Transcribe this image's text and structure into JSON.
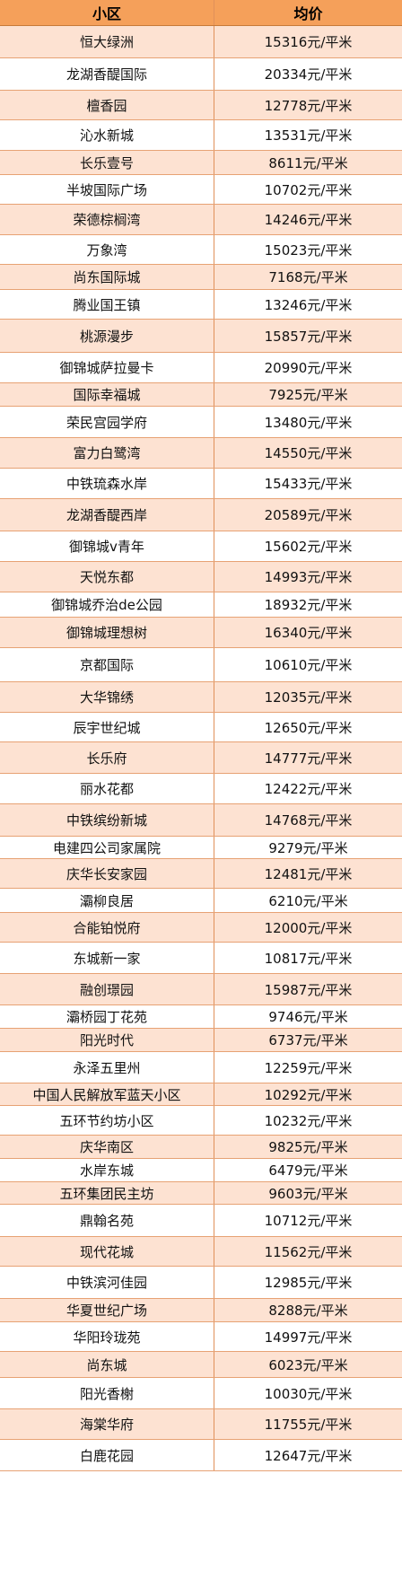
{
  "header": {
    "col1": "小区",
    "col2": "均价"
  },
  "rows": [
    {
      "name": "恒大绿洲",
      "price": "15316元/平米"
    },
    {
      "name": "龙湖香醍国际",
      "price": "20334元/平米"
    },
    {
      "name": "檀香园",
      "price": "12778元/平米"
    },
    {
      "name": "沁水新城",
      "price": "13531元/平米"
    },
    {
      "name": "长乐壹号",
      "price": "8611元/平米"
    },
    {
      "name": "半坡国际广场",
      "price": "10702元/平米"
    },
    {
      "name": "荣德棕榈湾",
      "price": "14246元/平米"
    },
    {
      "name": "万象湾",
      "price": "15023元/平米"
    },
    {
      "name": "尚东国际城",
      "price": "7168元/平米"
    },
    {
      "name": "腾业国王镇",
      "price": "13246元/平米"
    },
    {
      "name": "桃源漫步",
      "price": "15857元/平米"
    },
    {
      "name": "御锦城萨拉曼卡",
      "price": "20990元/平米"
    },
    {
      "name": "国际幸福城",
      "price": "7925元/平米"
    },
    {
      "name": "荣民宫园学府",
      "price": "13480元/平米"
    },
    {
      "name": "富力白鹭湾",
      "price": "14550元/平米"
    },
    {
      "name": "中铁琉森水岸",
      "price": "15433元/平米"
    },
    {
      "name": "龙湖香醍西岸",
      "price": "20589元/平米"
    },
    {
      "name": "御锦城v青年",
      "price": "15602元/平米"
    },
    {
      "name": "天悦东都",
      "price": "14993元/平米"
    },
    {
      "name": "御锦城乔治de公园",
      "price": "18932元/平米"
    },
    {
      "name": "御锦城理想树",
      "price": "16340元/平米"
    },
    {
      "name": "京都国际",
      "price": "10610元/平米"
    },
    {
      "name": "大华锦绣",
      "price": "12035元/平米"
    },
    {
      "name": "辰宇世纪城",
      "price": "12650元/平米"
    },
    {
      "name": "长乐府",
      "price": "14777元/平米"
    },
    {
      "name": "丽水花都",
      "price": "12422元/平米"
    },
    {
      "name": "中铁缤纷新城",
      "price": "14768元/平米"
    },
    {
      "name": "电建四公司家属院",
      "price": "9279元/平米"
    },
    {
      "name": "庆华长安家园",
      "price": "12481元/平米"
    },
    {
      "name": "灞柳良居",
      "price": "6210元/平米"
    },
    {
      "name": "合能铂悦府",
      "price": "12000元/平米"
    },
    {
      "name": "东城新一家",
      "price": "10817元/平米"
    },
    {
      "name": "融创璟园",
      "price": "15987元/平米"
    },
    {
      "name": "灞桥园丁花苑",
      "price": "9746元/平米"
    },
    {
      "name": "阳光时代",
      "price": "6737元/平米"
    },
    {
      "name": "永泽五里州",
      "price": "12259元/平米"
    },
    {
      "name": "中国人民解放军蓝天小区",
      "price": "10292元/平米"
    },
    {
      "name": "五环节约坊小区",
      "price": "10232元/平米"
    },
    {
      "name": "庆华南区",
      "price": "9825元/平米"
    },
    {
      "name": "水岸东城",
      "price": "6479元/平米"
    },
    {
      "name": "五环集团民主坊",
      "price": "9603元/平米"
    },
    {
      "name": "鼎翰名苑",
      "price": "10712元/平米"
    },
    {
      "name": "现代花城",
      "price": "11562元/平米"
    },
    {
      "name": "中铁滨河佳园",
      "price": "12985元/平米"
    },
    {
      "name": "华夏世纪广场",
      "price": "8288元/平米"
    },
    {
      "name": "华阳玲珑苑",
      "price": "14997元/平米"
    },
    {
      "name": "尚东城",
      "price": "6023元/平米"
    },
    {
      "name": "阳光香榭",
      "price": "10030元/平米"
    },
    {
      "name": "海棠华府",
      "price": "11755元/平米"
    },
    {
      "name": "白鹿花园",
      "price": "12647元/平米"
    }
  ]
}
